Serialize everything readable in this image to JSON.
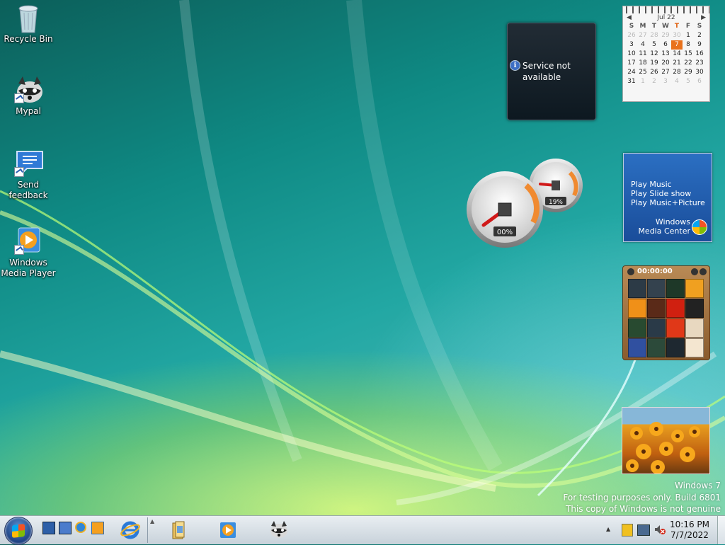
{
  "desktop": {
    "icons": [
      {
        "label": "Recycle Bin"
      },
      {
        "label": "Mypal"
      },
      {
        "label": "Send\nfeedback"
      },
      {
        "label": "Windows\nMedia Player"
      }
    ]
  },
  "gadgets": {
    "weather": {
      "message": "Service not available"
    },
    "calendar": {
      "month": "Jul 22",
      "weekdays": [
        "S",
        "M",
        "T",
        "W",
        "T",
        "F",
        "S"
      ],
      "days": [
        [
          "26",
          "27",
          "28",
          "29",
          "30",
          "1",
          "2"
        ],
        [
          "3",
          "4",
          "5",
          "6",
          "7",
          "8",
          "9"
        ],
        [
          "10",
          "11",
          "12",
          "13",
          "14",
          "15",
          "16"
        ],
        [
          "17",
          "18",
          "19",
          "20",
          "21",
          "22",
          "23"
        ],
        [
          "24",
          "25",
          "26",
          "27",
          "28",
          "29",
          "30"
        ],
        [
          "31",
          "1",
          "2",
          "3",
          "4",
          "5",
          "6"
        ]
      ],
      "today": "7"
    },
    "cpu_meter": {
      "cpu": "00%",
      "memory": "19%",
      "cpu_value": 0,
      "memory_value": 19
    },
    "media_center": {
      "items": [
        "Play Music",
        "Play Slide show",
        "Play Music+Picture"
      ],
      "brand_line1": "Windows",
      "brand_line2": "Media Center"
    },
    "puzzle": {
      "timer": "00:00:00"
    }
  },
  "watermark": {
    "line1": "Windows 7",
    "line2": "For testing purposes only. Build 6801",
    "line3": "This copy of Windows is not genuine"
  },
  "taskbar": {
    "clock_time": "10:16 PM",
    "clock_date": "7/7/2022"
  },
  "colors": {
    "accent_today": "#e9721c",
    "wmc_blue": "#2b6fc2"
  }
}
